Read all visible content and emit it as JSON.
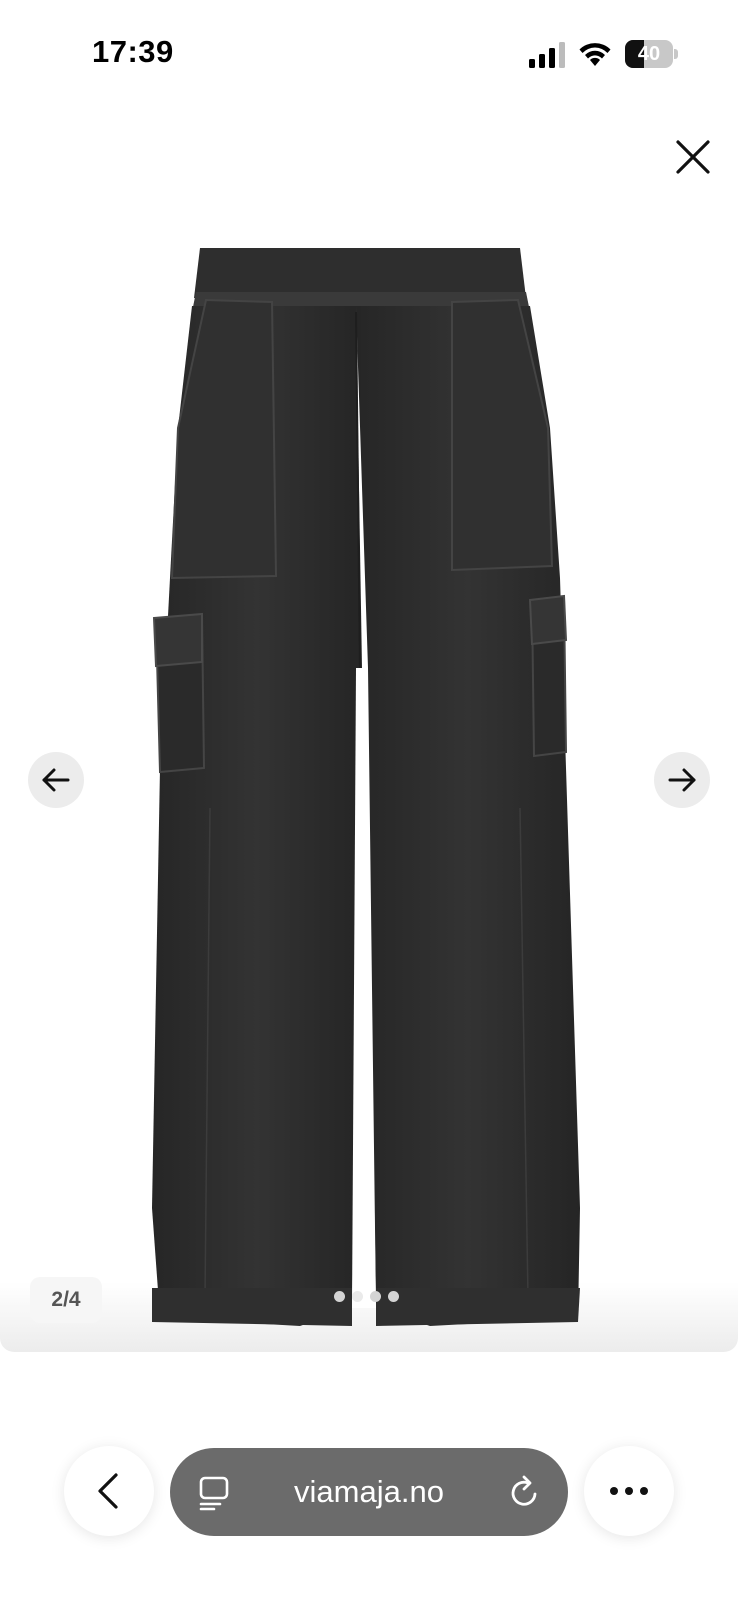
{
  "status_bar": {
    "time": "17:39",
    "battery_percent": "40",
    "battery_level": 0.4
  },
  "product": {
    "image_counter": "2/4",
    "total_images": 4,
    "current_image": 2
  },
  "browser": {
    "address": "viamaja.no"
  },
  "icons": {
    "close": "close-icon",
    "prev": "arrow-left-icon",
    "next": "arrow-right-icon",
    "back": "chevron-left-icon",
    "tabs": "tabs-icon",
    "reload": "reload-icon",
    "more": "more-dots-icon"
  },
  "colors": {
    "garment": "#2b2b2b",
    "pill": "#6b6b6b",
    "nav_button": "#ececec"
  }
}
